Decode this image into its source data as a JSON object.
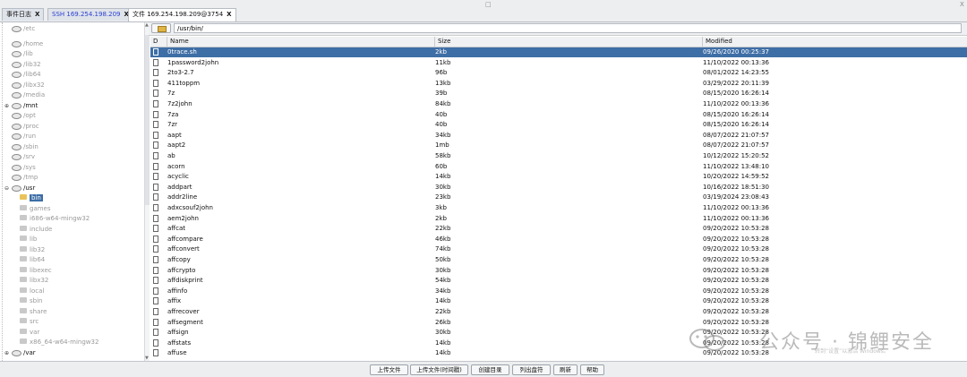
{
  "tabs": [
    {
      "label": "事件日志",
      "close": "X"
    },
    {
      "label": "SSH 169.254.198.209",
      "close": "X"
    },
    {
      "label": "文件 169.254.198.209@3754",
      "close": "X"
    }
  ],
  "window_controls": {
    "restore": "□",
    "close": "X"
  },
  "tree": {
    "items": [
      {
        "label": "/etc"
      },
      {
        "label": "/home"
      },
      {
        "label": "/lib"
      },
      {
        "label": "/lib32"
      },
      {
        "label": "/lib64"
      },
      {
        "label": "/libx32"
      },
      {
        "label": "/media"
      },
      {
        "label": "/mnt"
      },
      {
        "label": "/opt"
      },
      {
        "label": "/proc"
      },
      {
        "label": "/run"
      },
      {
        "label": "/sbin"
      },
      {
        "label": "/srv"
      },
      {
        "label": "/sys"
      },
      {
        "label": "/tmp"
      },
      {
        "label": "/usr"
      },
      {
        "label": "bin"
      },
      {
        "label": "games"
      },
      {
        "label": "i686-w64-mingw32"
      },
      {
        "label": "include"
      },
      {
        "label": "lib"
      },
      {
        "label": "lib32"
      },
      {
        "label": "lib64"
      },
      {
        "label": "libexec"
      },
      {
        "label": "libx32"
      },
      {
        "label": "local"
      },
      {
        "label": "sbin"
      },
      {
        "label": "share"
      },
      {
        "label": "src"
      },
      {
        "label": "var"
      },
      {
        "label": "x86_64-w64-mingw32"
      },
      {
        "label": "/var"
      }
    ]
  },
  "path": {
    "value": "/usr/bin/"
  },
  "table": {
    "headers": {
      "d": "D",
      "name": "Name",
      "size": "Size",
      "modified": "Modified"
    },
    "rows": [
      {
        "name": "0trace.sh",
        "size": "2kb",
        "modified": "09/26/2020 00:25:37"
      },
      {
        "name": "1password2john",
        "size": "11kb",
        "modified": "11/10/2022 00:13:36"
      },
      {
        "name": "2to3-2.7",
        "size": "96b",
        "modified": "08/01/2022 14:23:55"
      },
      {
        "name": "411toppm",
        "size": "13kb",
        "modified": "03/29/2022 20:11:39"
      },
      {
        "name": "7z",
        "size": "39b",
        "modified": "08/15/2020 16:26:14"
      },
      {
        "name": "7z2john",
        "size": "84kb",
        "modified": "11/10/2022 00:13:36"
      },
      {
        "name": "7za",
        "size": "40b",
        "modified": "08/15/2020 16:26:14"
      },
      {
        "name": "7zr",
        "size": "40b",
        "modified": "08/15/2020 16:26:14"
      },
      {
        "name": "aapt",
        "size": "34kb",
        "modified": "08/07/2022 21:07:57"
      },
      {
        "name": "aapt2",
        "size": "1mb",
        "modified": "08/07/2022 21:07:57"
      },
      {
        "name": "ab",
        "size": "58kb",
        "modified": "10/12/2022 15:20:52"
      },
      {
        "name": "acorn",
        "size": "60b",
        "modified": "11/10/2022 13:48:10"
      },
      {
        "name": "acyclic",
        "size": "14kb",
        "modified": "10/20/2022 14:59:52"
      },
      {
        "name": "addpart",
        "size": "30kb",
        "modified": "10/16/2022 18:51:30"
      },
      {
        "name": "addr2line",
        "size": "23kb",
        "modified": "03/19/2024 23:08:43"
      },
      {
        "name": "adxcsouf2john",
        "size": "3kb",
        "modified": "11/10/2022 00:13:36"
      },
      {
        "name": "aem2john",
        "size": "2kb",
        "modified": "11/10/2022 00:13:36"
      },
      {
        "name": "affcat",
        "size": "22kb",
        "modified": "09/20/2022 10:53:28"
      },
      {
        "name": "affcompare",
        "size": "46kb",
        "modified": "09/20/2022 10:53:28"
      },
      {
        "name": "affconvert",
        "size": "74kb",
        "modified": "09/20/2022 10:53:28"
      },
      {
        "name": "affcopy",
        "size": "50kb",
        "modified": "09/20/2022 10:53:28"
      },
      {
        "name": "affcrypto",
        "size": "30kb",
        "modified": "09/20/2022 10:53:28"
      },
      {
        "name": "affdiskprint",
        "size": "54kb",
        "modified": "09/20/2022 10:53:28"
      },
      {
        "name": "affinfo",
        "size": "34kb",
        "modified": "09/20/2022 10:53:28"
      },
      {
        "name": "affix",
        "size": "14kb",
        "modified": "09/20/2022 10:53:28"
      },
      {
        "name": "affrecover",
        "size": "22kb",
        "modified": "09/20/2022 10:53:28"
      },
      {
        "name": "affsegment",
        "size": "26kb",
        "modified": "09/20/2022 10:53:28"
      },
      {
        "name": "affsign",
        "size": "30kb",
        "modified": "09/20/2022 10:53:28"
      },
      {
        "name": "affstats",
        "size": "14kb",
        "modified": "09/20/2022 10:53:28"
      },
      {
        "name": "affuse",
        "size": "14kb",
        "modified": "09/20/2022 10:53:28"
      }
    ]
  },
  "toolbar": {
    "upload": "上传文件",
    "upload_timed": "上传文件(时间戳)",
    "mkdir": "创建目录",
    "list_drives": "列出盘符",
    "refresh": "刷新",
    "help": "帮助"
  },
  "watermark": {
    "text": "公众号 · 锦鲤安全",
    "sub": "转到“设置”以激活 Windows。"
  }
}
